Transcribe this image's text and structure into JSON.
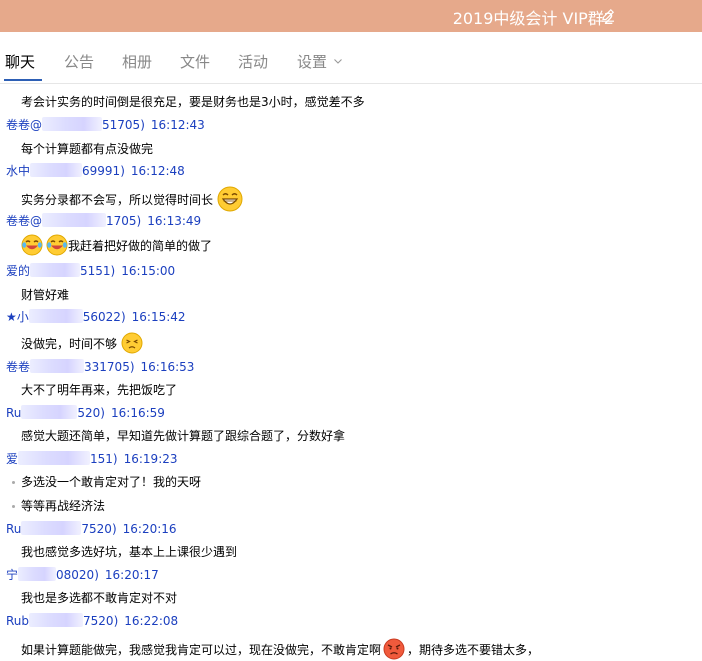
{
  "window": {
    "title": "2019中级会计 VIP群2"
  },
  "tabs": [
    {
      "label": "聊天"
    },
    {
      "label": "公告"
    },
    {
      "label": "相册"
    },
    {
      "label": "文件"
    },
    {
      "label": "活动"
    },
    {
      "label": "设置"
    }
  ],
  "messages": [
    {
      "text": "考会计实务的时间倒是很充足，要是财务也是3小时，感觉差不多"
    },
    {
      "sender": "卷卷@",
      "id": "51705)",
      "time": "16:12:43"
    },
    {
      "text": "每个计算题都有点没做完"
    },
    {
      "sender": "水中",
      "id": "69991)",
      "time": "16:12:48"
    },
    {
      "text": "实务分录都不会写，所以觉得时间长"
    },
    {
      "sender": "卷卷@",
      "id": "1705)",
      "time": "16:13:49"
    },
    {
      "text": "我赶着把好做的简单的做了"
    },
    {
      "sender": "爱的",
      "id": "5151)",
      "time": "16:15:00"
    },
    {
      "text": "财管好难"
    },
    {
      "sender": "★小",
      "id": "56022)",
      "time": "16:15:42"
    },
    {
      "text": "没做完，时间不够"
    },
    {
      "sender": "卷卷",
      "id": "331705)",
      "time": "16:16:53"
    },
    {
      "text": "大不了明年再来，先把饭吃了"
    },
    {
      "sender": "Ru",
      "id": "520)",
      "time": "16:16:59"
    },
    {
      "text": "感觉大题还简单，早知道先做计算题了跟综合题了，分数好拿"
    },
    {
      "sender": "爱",
      "id": "151)",
      "time": "16:19:23"
    },
    {
      "text": "多选没一个敢肯定对了！我的天呀"
    },
    {
      "text": "等等再战经济法"
    },
    {
      "sender": "Ru",
      "id": "7520)",
      "time": "16:20:16"
    },
    {
      "text": "我也感觉多选好坑，基本上上课很少遇到"
    },
    {
      "sender": "宁",
      "id": "08020)",
      "time": "16:20:17"
    },
    {
      "text": "我也是多选都不敢肯定对不对"
    },
    {
      "sender": "Rub",
      "id": "7520)",
      "time": "16:22:08"
    },
    {
      "text": "如果计算题能做完，我感觉我肯定可以过，现在没做完，不敢肯定啊",
      "text_after": "，期待多选不要错太多，"
    }
  ],
  "colors": {
    "titlebar": "#e6a98b",
    "sender_link": "#1b3fbf",
    "active_tab_underline": "#2d5fb5"
  },
  "icons": [
    "edit-icon",
    "chevron-down-icon",
    "grin-emoji",
    "laughing-tears-emoji",
    "sad-emoji",
    "angry-emoji"
  ]
}
